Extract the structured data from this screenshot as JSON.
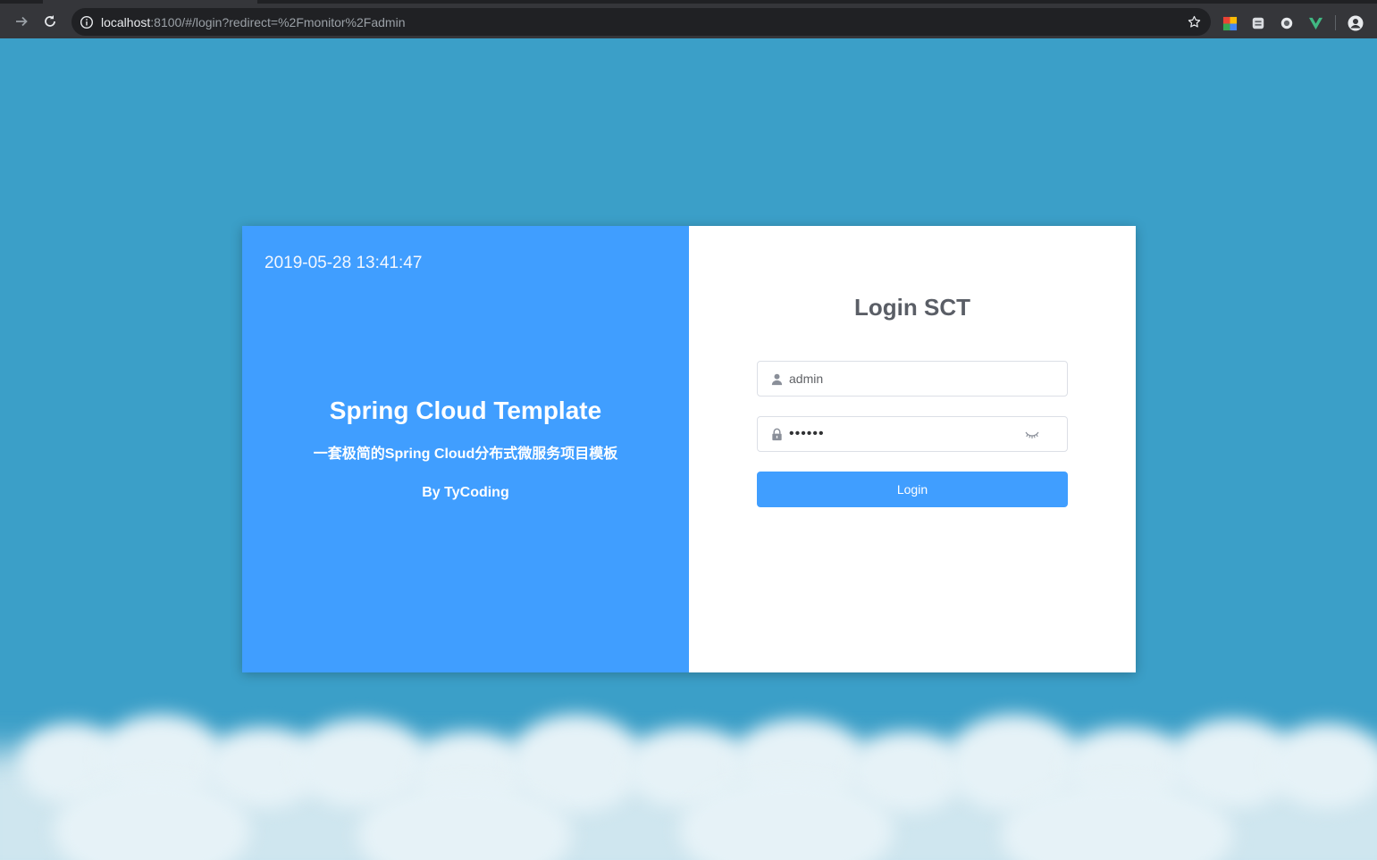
{
  "browser": {
    "url_host": "localhost",
    "url_rest": ":8100/#/login?redirect=%2Fmonitor%2Fadmin",
    "icons": [
      "forward-arrow-icon",
      "reload-icon",
      "site-info-icon",
      "bookmark-star-icon",
      "extension-icon",
      "extension-icon",
      "extension-icon",
      "vue-devtools-icon",
      "profile-icon"
    ]
  },
  "left_panel": {
    "clock": "2019-05-28 13:41:47",
    "title": "Spring Cloud Template",
    "subtitle": "一套极简的Spring Cloud分布式微服务项目模板",
    "author": "By TyCoding",
    "background": "#409eff"
  },
  "login_form": {
    "title": "Login SCT",
    "username_value": "admin",
    "password_value": "••••••",
    "submit_label": "Login",
    "accent": "#409eff"
  },
  "page": {
    "background": "#3b9fc8"
  }
}
